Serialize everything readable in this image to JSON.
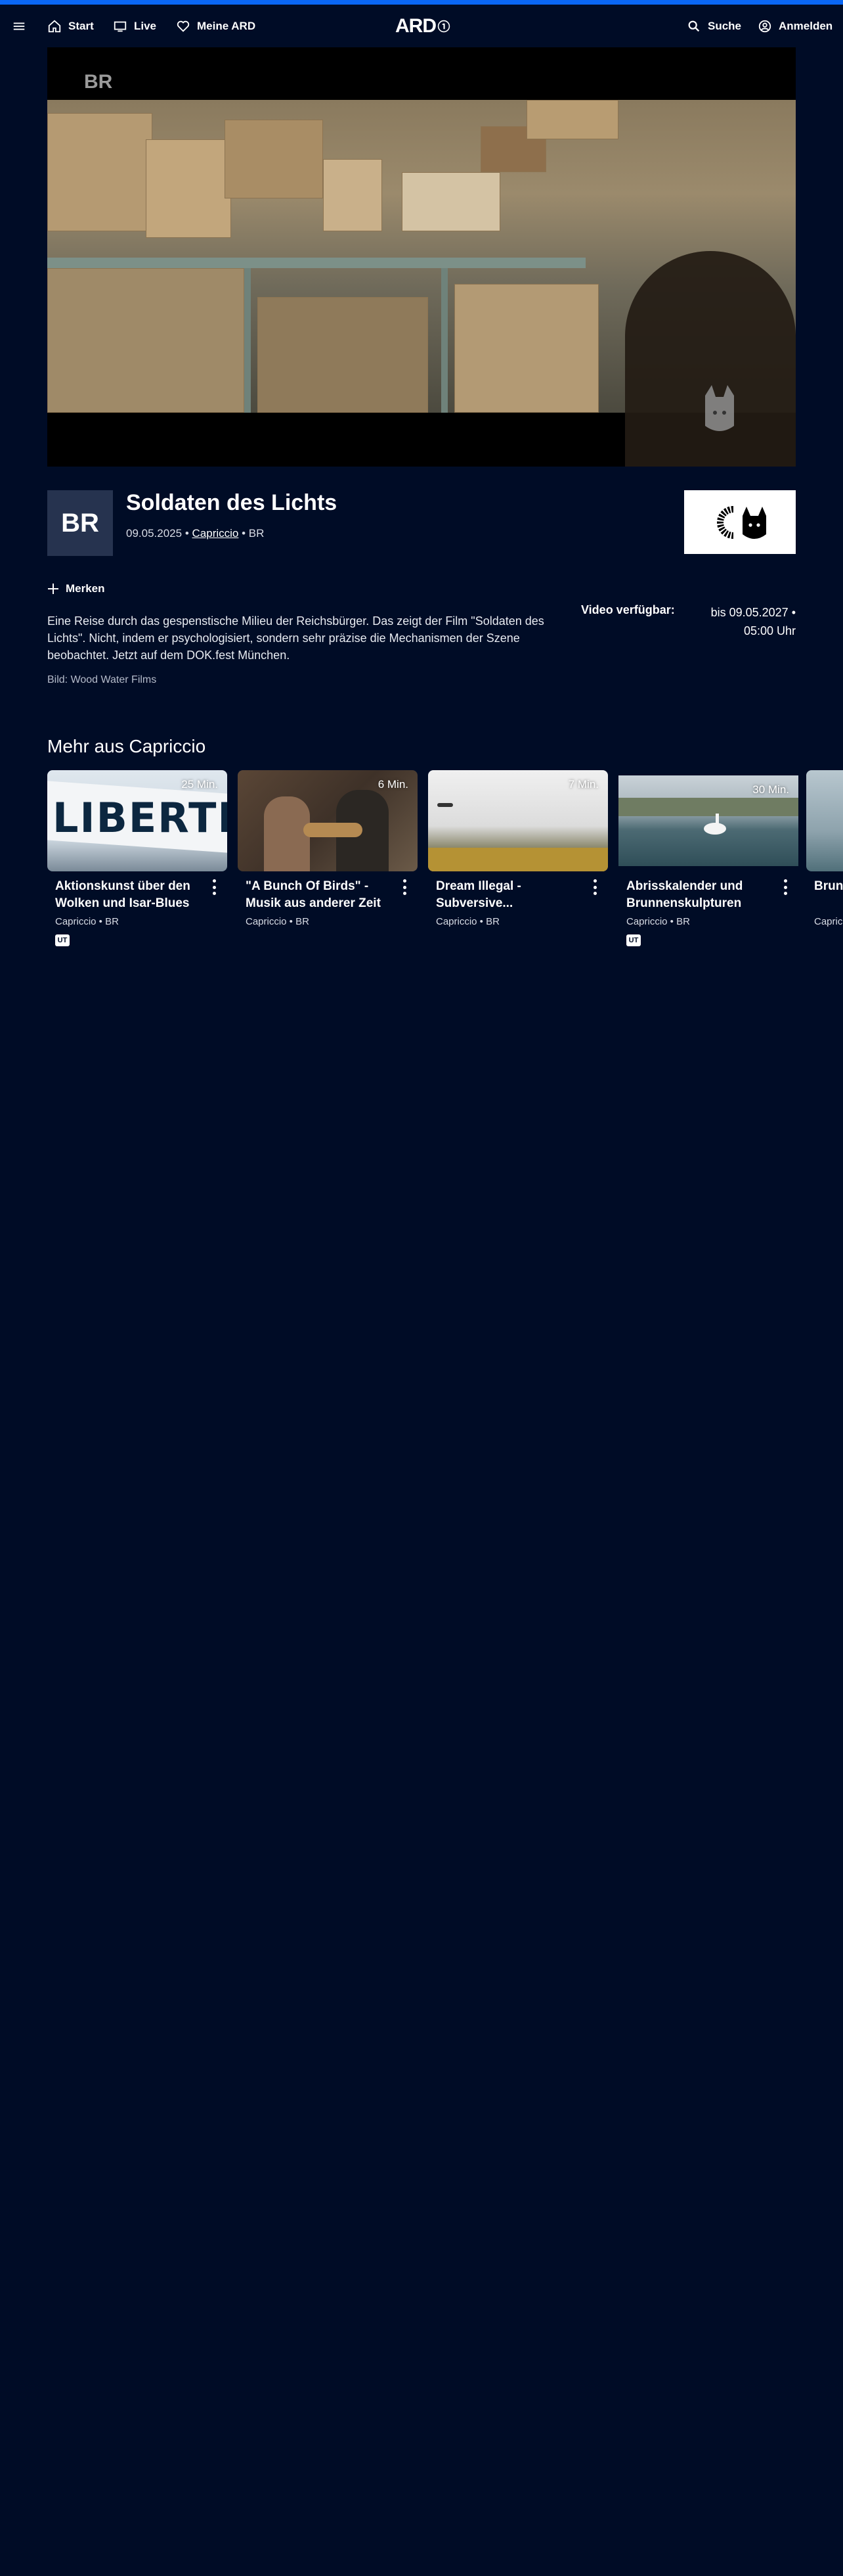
{
  "nav": {
    "start": "Start",
    "live": "Live",
    "meine": "Meine ARD",
    "logo": "ARD",
    "suche": "Suche",
    "anmelden": "Anmelden"
  },
  "player": {
    "watermark": "BR"
  },
  "video": {
    "channel_logo": "BR",
    "title": "Soldaten des Lichts",
    "date": "09.05.2025",
    "show": "Capriccio",
    "broadcaster": "BR",
    "separator": "•",
    "merken": "Merken",
    "description": "Eine Reise durch das gespenstische Milieu der Reichsbürger. Das zeigt der Film \"Soldaten des Lichts\". Nicht, indem er psychologisiert, sondern sehr präzise die Mechanismen der Szene beobachtet. Jetzt auf dem DOK.fest München.",
    "credit": "Bild: Wood Water Films",
    "avail_label": "Video verfügbar:",
    "avail_value": "bis 09.05.2027 • 05:00 Uhr"
  },
  "section": {
    "title": "Mehr aus Capriccio"
  },
  "cards": [
    {
      "duration": "25 Min.",
      "title": "Aktionskunst über den Wolken und Isar-Blues",
      "meta": "Capriccio • BR",
      "badge": "UT"
    },
    {
      "duration": "6 Min.",
      "title": "\"A Bunch Of Birds\" - Musik aus anderer Zeit",
      "meta": "Capriccio • BR",
      "badge": ""
    },
    {
      "duration": "7 Min.",
      "title": "Dream Illegal - Subversive...",
      "meta": "Capriccio • BR",
      "badge": ""
    },
    {
      "duration": "30 Min.",
      "title": "Abrisskalender und Brunnenskulpturen",
      "meta": "Capriccio • BR",
      "badge": "UT"
    },
    {
      "duration": "",
      "title": "Brun",
      "meta": "Capric",
      "badge": ""
    }
  ],
  "colors": {
    "background": "#000c26",
    "accent": "#0a67f5",
    "channel_tile": "#26334f"
  }
}
